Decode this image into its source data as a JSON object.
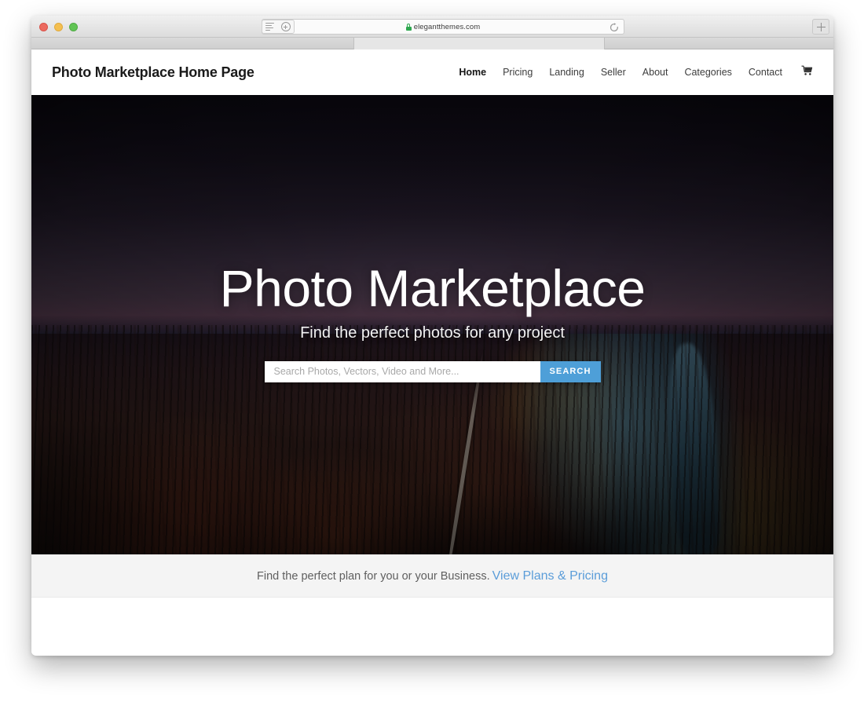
{
  "browser": {
    "traffic_lights": [
      "close",
      "minimize",
      "zoom"
    ],
    "sidebar_icon": "list-lines-icon",
    "add_icon": "plus-circle-icon",
    "url": "elegantthemes.com",
    "lock_icon": "lock-icon",
    "reload_icon": "reload-icon",
    "new_tab_icon": "plus-icon"
  },
  "header": {
    "logo": "Photo Marketplace Home Page",
    "nav": [
      {
        "label": "Home",
        "active": true
      },
      {
        "label": "Pricing",
        "active": false
      },
      {
        "label": "Landing",
        "active": false
      },
      {
        "label": "Seller",
        "active": false
      },
      {
        "label": "About",
        "active": false
      },
      {
        "label": "Categories",
        "active": false
      },
      {
        "label": "Contact",
        "active": false
      }
    ],
    "cart_icon": "shopping-cart-icon"
  },
  "hero": {
    "title": "Photo Marketplace",
    "subtitle": "Find the perfect photos for any project",
    "search": {
      "placeholder": "Search Photos, Vectors, Video and More...",
      "value": "",
      "button_label": "SEARCH",
      "button_color": "#4e9fd8"
    },
    "background_description": "Aerial photo of autumn forest with winding road and river at dusk"
  },
  "cta": {
    "text": "Find the perfect plan for you or your Business.",
    "link_label": "View Plans & Pricing",
    "link_color": "#5b9dd9"
  }
}
